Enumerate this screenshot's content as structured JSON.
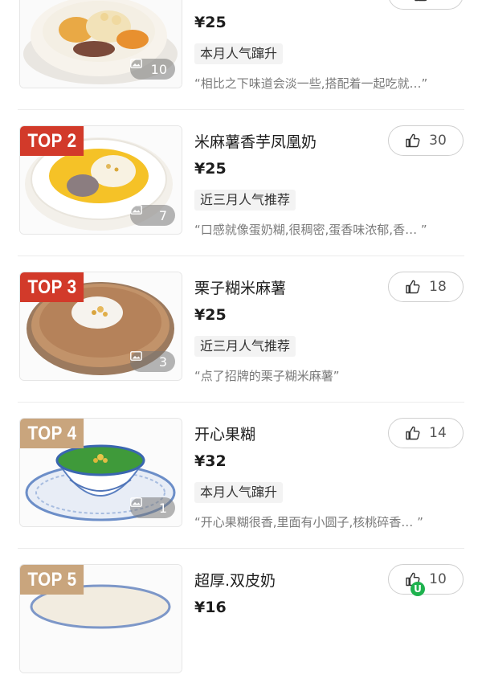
{
  "items": [
    {
      "rank": "",
      "name": "",
      "price": "¥25",
      "tag": "本月人气蹿升",
      "quote": "“相比之下味道会淡一些,搭配着一起吃就…”",
      "likes": "",
      "image_count": "10",
      "badge_color": "#d23a2a"
    },
    {
      "rank": "TOP 2",
      "name": "米麻薯香芋凤凰奶",
      "price": "¥25",
      "tag": "近三月人气推荐",
      "quote": "“口感就像蛋奶糊,很稠密,蛋香味浓郁,香…  ”",
      "likes": "30",
      "image_count": "7",
      "badge_color": "#d23a2a"
    },
    {
      "rank": "TOP 3",
      "name": "栗子糊米麻薯",
      "price": "¥25",
      "tag": "近三月人气推荐",
      "quote": "“点了招牌的栗子糊米麻薯”",
      "likes": "18",
      "image_count": "3",
      "badge_color": "#d23a2a"
    },
    {
      "rank": "TOP 4",
      "name": "开心果糊",
      "price": "¥32",
      "tag": "本月人气蹿升",
      "quote": "“开心果糊很香,里面有小圆子,核桃碎香…  ”",
      "likes": "14",
      "image_count": "1",
      "badge_color": "#c9a57d"
    },
    {
      "rank": "TOP 5",
      "name": "超厚.双皮奶",
      "price": "¥16",
      "tag": "",
      "quote": "",
      "likes": "10",
      "image_count": "",
      "badge_color": "#c9a57d"
    }
  ],
  "overlay_badge": "U",
  "colors": {
    "accent": "#d23a2a",
    "tan": "#c9a57d",
    "ubadge": "#1eb24e"
  }
}
